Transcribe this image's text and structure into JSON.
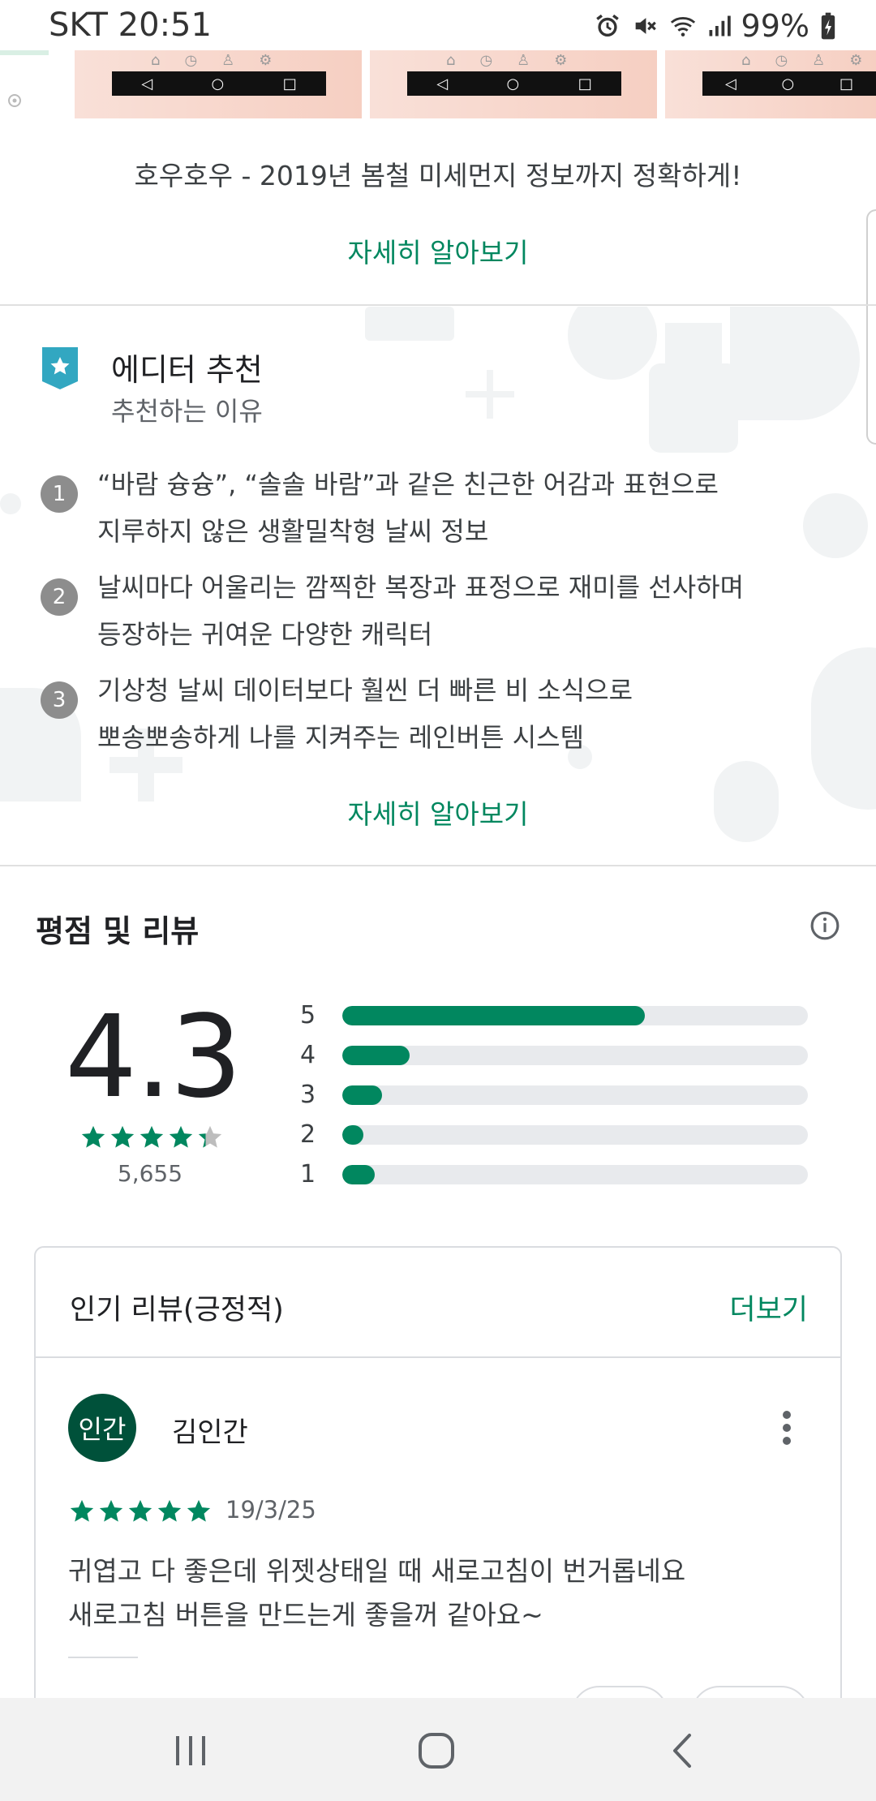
{
  "status_bar": {
    "carrier_time": "SKT 20:51",
    "battery": "99%",
    "icons": [
      "alarm-icon",
      "mute-icon",
      "wifi-icon",
      "signal-icon",
      "battery-charging-icon"
    ]
  },
  "promo": {
    "text": "호우호우 - 2019년 봄철 미세먼지 정보까지 정확하게!",
    "learn_more": "자세히 알아보기"
  },
  "editor": {
    "title": "에디터 추천",
    "subtitle": "추천하는 이유",
    "reasons": [
      {
        "num": "1",
        "line1": "“바람 슝슝”, “솔솔 바람”과 같은 친근한 어감과 표현으로",
        "line2": "지루하지 않은 생활밀착형 날씨 정보"
      },
      {
        "num": "2",
        "line1": "날씨마다 어울리는 깜찍한 복장과 표정으로 재미를 선사하며",
        "line2": "등장하는 귀여운 다양한 캐릭터"
      },
      {
        "num": "3",
        "line1": "기상청 날씨 데이터보다 훨씬 더 빠른 비 소식으로",
        "line2": "뽀송뽀송하게 나를 지켜주는 레인버튼 시스템"
      }
    ],
    "learn_more": "자세히 알아보기"
  },
  "ratings": {
    "title": "평점 및 리뷰",
    "score": "4.3",
    "stars": 4.3,
    "count": "5,655",
    "distribution": [
      {
        "label": "5",
        "fraction": 0.65
      },
      {
        "label": "4",
        "fraction": 0.145
      },
      {
        "label": "3",
        "fraction": 0.085
      },
      {
        "label": "2",
        "fraction": 0.045
      },
      {
        "label": "1",
        "fraction": 0.07
      }
    ],
    "accent": "#01875f"
  },
  "review_card": {
    "title": "인기 리뷰(긍정적)",
    "more": "더보기",
    "avatar_text": "인간",
    "reviewer": "김인간",
    "stars": 5,
    "date": "19/3/25",
    "line1": "귀엽고 다 좋은데 위젯상태일 때 새로고침이 번거롭네요",
    "line2": "새로고침 버튼을 만드는게 좋을꺼 같아요~"
  },
  "bottom_nav": {
    "icons": [
      "recents-icon",
      "home-icon",
      "back-icon"
    ]
  }
}
